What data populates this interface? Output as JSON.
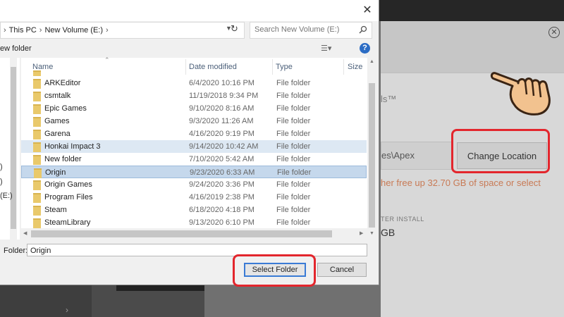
{
  "dialog": {
    "close_glyph": "✕",
    "breadcrumb": [
      "This PC",
      "New Volume (E:)"
    ],
    "breadcrumb_sep": "›",
    "refresh_glyph": "↻",
    "search_placeholder": "Search New Volume (E:)",
    "new_folder_label": "ew folder",
    "columns": {
      "name": "Name",
      "date": "Date modified",
      "type": "Type",
      "size": "Size"
    },
    "rows": [
      {
        "name": "ARKEditor",
        "date": "6/4/2020 10:16 PM",
        "type": "File folder"
      },
      {
        "name": "csmtalk",
        "date": "11/19/2018 9:34 PM",
        "type": "File folder"
      },
      {
        "name": "Epic Games",
        "date": "9/10/2020 8:16 AM",
        "type": "File folder"
      },
      {
        "name": "Games",
        "date": "9/3/2020 11:26 AM",
        "type": "File folder"
      },
      {
        "name": "Garena",
        "date": "4/16/2020 9:19 PM",
        "type": "File folder"
      },
      {
        "name": "Honkai Impact 3",
        "date": "9/14/2020 10:42 AM",
        "type": "File folder"
      },
      {
        "name": "New folder",
        "date": "7/10/2020 5:42 AM",
        "type": "File folder"
      },
      {
        "name": "Origin",
        "date": "9/23/2020 6:33 AM",
        "type": "File folder"
      },
      {
        "name": "Origin Games",
        "date": "9/24/2020 3:36 PM",
        "type": "File folder"
      },
      {
        "name": "Program Files",
        "date": "4/16/2019 2:38 PM",
        "type": "File folder"
      },
      {
        "name": "Steam",
        "date": "6/18/2020 4:18 PM",
        "type": "File folder"
      },
      {
        "name": "SteamLibrary",
        "date": "9/13/2020 6:10 PM",
        "type": "File folder"
      }
    ],
    "nav_items": [
      ")",
      ")",
      "(E:)"
    ],
    "folder_label": "Folder:",
    "folder_value": "Origin",
    "select_button": "Select Folder",
    "cancel_button": "Cancel"
  },
  "background": {
    "title_fragment": "ls™",
    "path_fragment": "es\\Apex",
    "change_location_button": "Change Location",
    "warning_fragment": "her free up 32.70 GB of space or select",
    "install_label_fragment": "TER INSTALL",
    "size_fragment": "GB"
  },
  "colors": {
    "highlight": "#e3262d",
    "selected_row": "#c5d8ec",
    "warning": "#c87a55"
  }
}
